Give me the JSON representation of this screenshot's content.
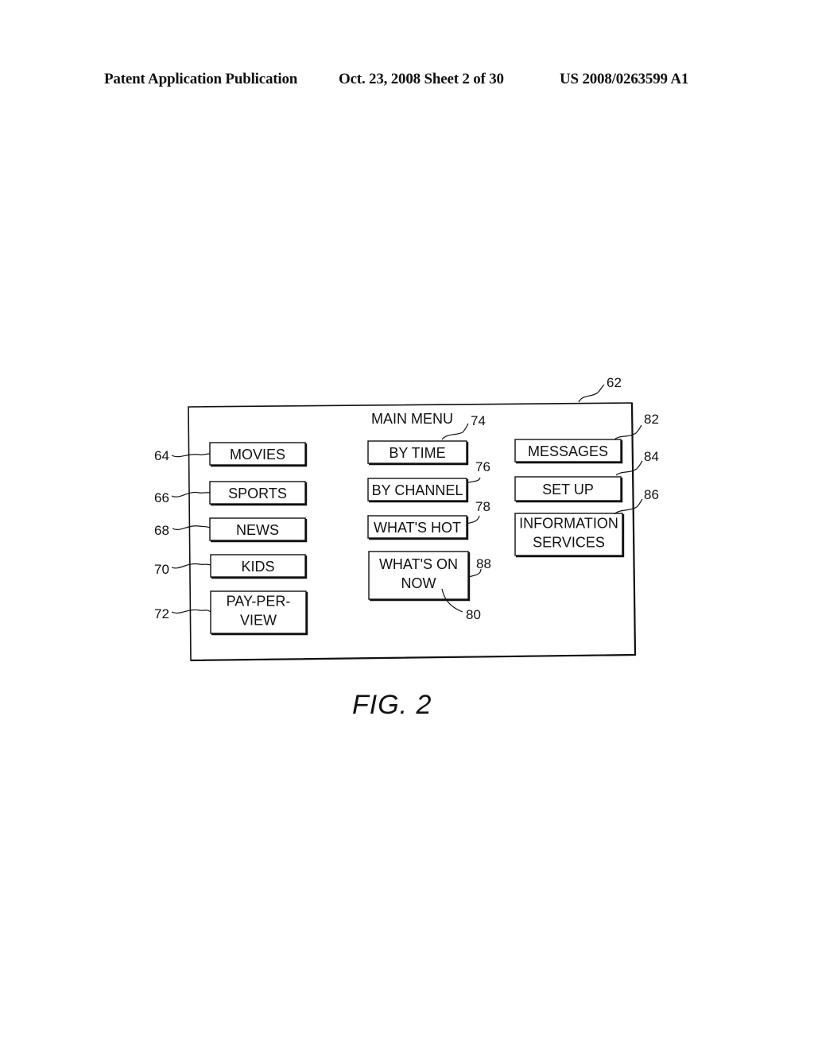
{
  "header": {
    "left": "Patent Application Publication",
    "middle": "Oct. 23, 2008  Sheet 2 of 30",
    "right": "US 2008/0263599 A1"
  },
  "figure": {
    "caption": "FIG. 2",
    "screen_ref": "62",
    "menu_title": "MAIN MENU",
    "left_column": [
      {
        "ref": "64",
        "lines": [
          "MOVIES"
        ]
      },
      {
        "ref": "66",
        "lines": [
          "SPORTS"
        ]
      },
      {
        "ref": "68",
        "lines": [
          "NEWS"
        ]
      },
      {
        "ref": "70",
        "lines": [
          "KIDS"
        ]
      },
      {
        "ref": "72",
        "lines": [
          "PAY-PER-",
          "VIEW"
        ]
      }
    ],
    "middle_column": [
      {
        "ref": "74",
        "lines": [
          "BY TIME"
        ]
      },
      {
        "ref": "76",
        "lines": [
          "BY CHANNEL"
        ]
      },
      {
        "ref": "78",
        "lines": [
          "WHAT'S HOT"
        ]
      },
      {
        "ref": "88",
        "lines": [
          "WHAT'S ON",
          "NOW"
        ],
        "highlighted": true,
        "cursor_ref": "80"
      }
    ],
    "right_column": [
      {
        "ref": "82",
        "lines": [
          "MESSAGES"
        ]
      },
      {
        "ref": "84",
        "lines": [
          "SET UP"
        ]
      },
      {
        "ref": "86",
        "lines": [
          "INFORMATION",
          "SERVICES"
        ]
      }
    ]
  }
}
